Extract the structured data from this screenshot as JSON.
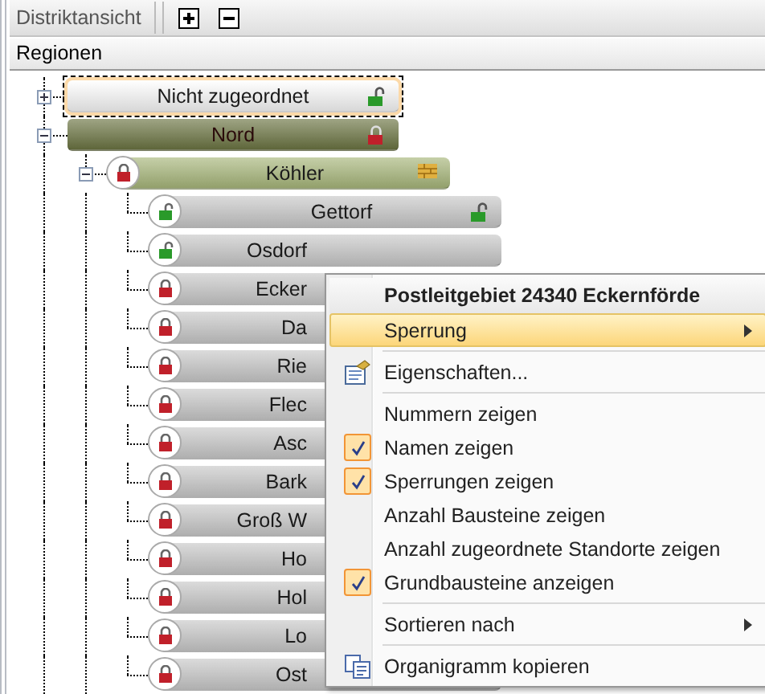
{
  "toolbar": {
    "title": "Distriktansicht",
    "buttons": [
      {
        "kind": "plus"
      },
      {
        "kind": "minus"
      }
    ]
  },
  "header": "Regionen",
  "tree": [
    {
      "kind": "root",
      "label": "Nicht zugeordnet",
      "color": "#e4e4e4",
      "locked": false,
      "focused": true,
      "expanded": false
    },
    {
      "kind": "root",
      "label": "Nord",
      "color": "#6b7442",
      "locked": true,
      "focused": false,
      "expanded": true,
      "children": [
        {
          "kind": "group",
          "label": "Köhler",
          "color": "#a7b67a",
          "locked": true,
          "focused": false,
          "expanded": true,
          "children": [
            {
              "kind": "district",
              "label": "Gettorf",
              "color": "#c8c8c8",
              "locked": false,
              "focused": false,
              "covered": false
            },
            {
              "kind": "district",
              "label": "Osdorf",
              "color": "#c8c8c8",
              "locked": false,
              "focused": false,
              "covered": true
            },
            {
              "kind": "district",
              "label": "Ecker",
              "color": "#c8c8c8",
              "locked": true,
              "focused": false,
              "covered": true
            },
            {
              "kind": "district",
              "label": "Da",
              "color": "#c8c8c8",
              "locked": true,
              "focused": false,
              "covered": true
            },
            {
              "kind": "district",
              "label": "Rie",
              "color": "#c8c8c8",
              "locked": true,
              "focused": false,
              "covered": true
            },
            {
              "kind": "district",
              "label": "Flec",
              "color": "#c8c8c8",
              "locked": true,
              "focused": false,
              "covered": true
            },
            {
              "kind": "district",
              "label": "Asc",
              "color": "#c8c8c8",
              "locked": true,
              "focused": false,
              "covered": true
            },
            {
              "kind": "district",
              "label": "Bark",
              "color": "#c8c8c8",
              "locked": true,
              "focused": false,
              "covered": true
            },
            {
              "kind": "district",
              "label": "Groß W",
              "color": "#c8c8c8",
              "locked": true,
              "focused": false,
              "covered": true
            },
            {
              "kind": "district",
              "label": "Ho",
              "color": "#c8c8c8",
              "locked": true,
              "focused": false,
              "covered": true
            },
            {
              "kind": "district",
              "label": "Hol",
              "color": "#c8c8c8",
              "locked": true,
              "focused": false,
              "covered": true
            },
            {
              "kind": "district",
              "label": "Lo",
              "color": "#c8c8c8",
              "locked": true,
              "focused": false,
              "covered": true
            },
            {
              "kind": "district",
              "label": "Ost",
              "color": "#c8c8c8",
              "locked": true,
              "focused": false,
              "covered": true
            }
          ]
        }
      ]
    }
  ],
  "context_menu": {
    "title": "Postleitgebiet 24340 Eckernförde",
    "items": [
      {
        "kind": "submenu",
        "label": "Sperrung",
        "selected": true,
        "checked": false
      },
      {
        "kind": "separator"
      },
      {
        "kind": "properties",
        "label": "Eigenschaften...",
        "selected": false,
        "checked": false
      },
      {
        "kind": "separator"
      },
      {
        "kind": "check",
        "label": "Nummern zeigen",
        "selected": false,
        "checked": false
      },
      {
        "kind": "check",
        "label": "Namen zeigen",
        "selected": false,
        "checked": true
      },
      {
        "kind": "check",
        "label": "Sperrungen zeigen",
        "selected": false,
        "checked": true
      },
      {
        "kind": "check",
        "label": "Anzahl Bausteine zeigen",
        "selected": false,
        "checked": false
      },
      {
        "kind": "check",
        "label": "Anzahl zugeordnete Standorte zeigen",
        "selected": false,
        "checked": false
      },
      {
        "kind": "check",
        "label": "Grundbausteine anzeigen",
        "selected": false,
        "checked": true
      },
      {
        "kind": "separator"
      },
      {
        "kind": "submenu",
        "label": "Sortieren nach",
        "selected": false,
        "checked": false
      },
      {
        "kind": "separator"
      },
      {
        "kind": "copy",
        "label": "Organigramm kopieren",
        "selected": false,
        "checked": false
      }
    ]
  }
}
